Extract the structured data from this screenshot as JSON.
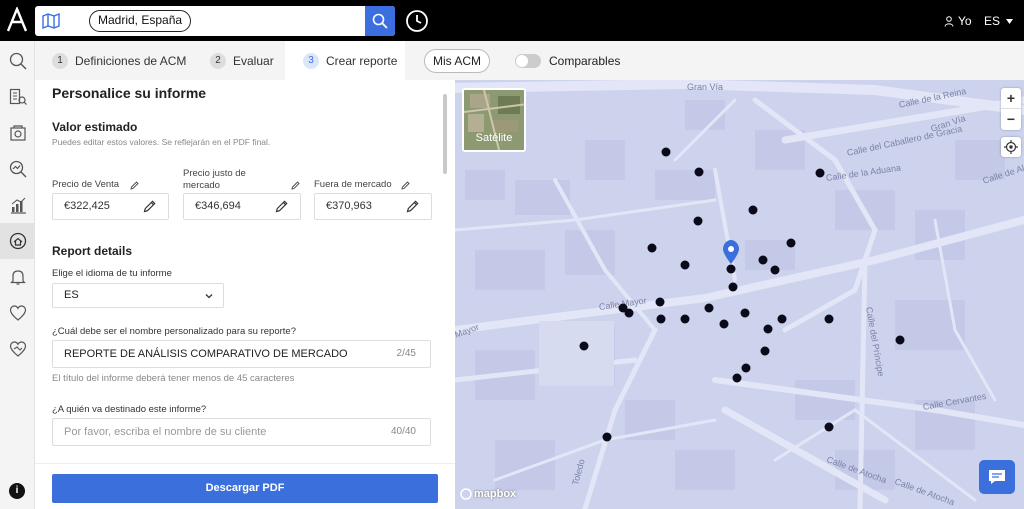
{
  "header": {
    "search_chip": "Madrid, España",
    "user_label": "Yo",
    "language": "ES"
  },
  "tabs": [
    {
      "num": "1",
      "label": "Definiciones de ACM"
    },
    {
      "num": "2",
      "label": "Evaluar"
    },
    {
      "num": "3",
      "label": "Crear reporte"
    }
  ],
  "mis_acm": "Mis ACM",
  "comparables_label": "Comparables",
  "form": {
    "title": "Personalice su informe",
    "valor_title": "Valor estimado",
    "valor_hint": "Puedes editar estos valores. Se reflejarán en el PDF final.",
    "prices": [
      {
        "label": "Precio de Venta",
        "value": "€322,425"
      },
      {
        "label": "Precio justo de mercado",
        "value": "€346,694"
      },
      {
        "label": "Fuera de mercado",
        "value": "€370,963"
      }
    ],
    "report_title": "Report details",
    "lang_label": "Elige el idioma de tu informe",
    "lang_value": "ES",
    "name_label": "¿Cuál debe ser el nombre personalizado para su reporte?",
    "name_value": "REPORTE DE ANÁLISIS COMPARATIVO  DE MERCADO",
    "name_count": "2/45",
    "name_hint": "El título del informe deberá tener menos de 45 caracteres",
    "client_label": "¿A quién va destinado este informe?",
    "client_placeholder": "Por favor, escriba el nombre de su cliente",
    "client_count": "40/40",
    "download": "Descargar PDF"
  },
  "map": {
    "satellite": "Satélite",
    "zoom_in": "+",
    "zoom_out": "−",
    "attribution": "mapbox",
    "streets": [
      "Gran Vía",
      "Calle de la Reina",
      "Gran Vía",
      "Calle del Caballero de Gracia",
      "Calle de la Aduana",
      "Calle de Al...",
      "Calle Mayor",
      "Calle del Príncipe",
      "Calle Cervantes",
      "Calle de Atocha",
      "Calle de Atocha",
      "Toledo",
      "Mayor"
    ]
  },
  "colors": {
    "accent": "#3a6fdc",
    "map_bg": "#cdd3ed",
    "dot": "#0a0a1a"
  }
}
